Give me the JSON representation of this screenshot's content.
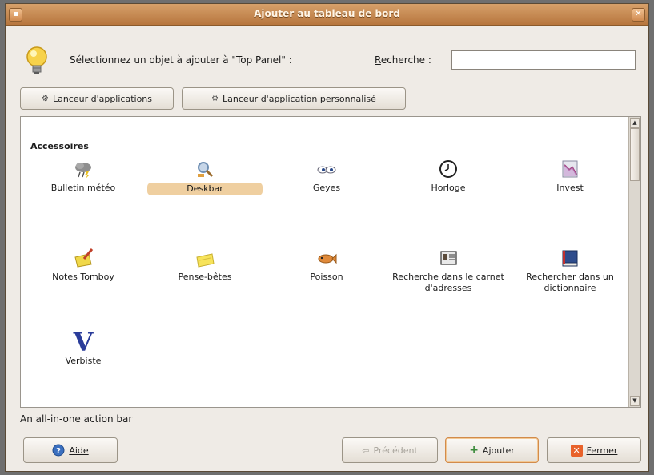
{
  "window": {
    "title": "Ajouter au tableau de bord",
    "menu_glyph": "▪",
    "close_glyph": "✕"
  },
  "header": {
    "prompt": "Sélectionnez un objet à ajouter à \"Top Panel\" :",
    "search_label": "Recherche :",
    "search_value": "",
    "search_placeholder": ""
  },
  "launcher_buttons": {
    "app_launcher": "Lanceur d'applications",
    "custom_launcher": "Lanceur d'application personnalisé"
  },
  "catalog": {
    "category": "Accessoires",
    "items": [
      {
        "label": "Bulletin météo",
        "icon": "weather-icon"
      },
      {
        "label": "Deskbar",
        "icon": "deskbar-icon",
        "selected": true
      },
      {
        "label": "Geyes",
        "icon": "eyes-icon"
      },
      {
        "label": "Horloge",
        "icon": "clock-icon"
      },
      {
        "label": "Invest",
        "icon": "invest-icon"
      },
      {
        "label": "Notes Tomboy",
        "icon": "tomboy-notes-icon"
      },
      {
        "label": "Pense-bêtes",
        "icon": "sticky-notes-icon"
      },
      {
        "label": "Poisson",
        "icon": "fish-icon"
      },
      {
        "label": "Recherche dans le carnet d'adresses",
        "icon": "address-book-icon"
      },
      {
        "label": "Rechercher dans un dictionnaire",
        "icon": "dictionary-icon"
      },
      {
        "label": "Verbiste",
        "icon": "verbiste-icon",
        "glyph": "V"
      }
    ]
  },
  "status": {
    "description": "An all-in-one action bar"
  },
  "footer": {
    "help": "Aide",
    "previous": "Précédent",
    "add": "Ajouter",
    "close": "Fermer"
  },
  "colors": {
    "titlebar": "#c58a52",
    "selection": "#efcfa0",
    "window_bg": "#efebe6"
  }
}
